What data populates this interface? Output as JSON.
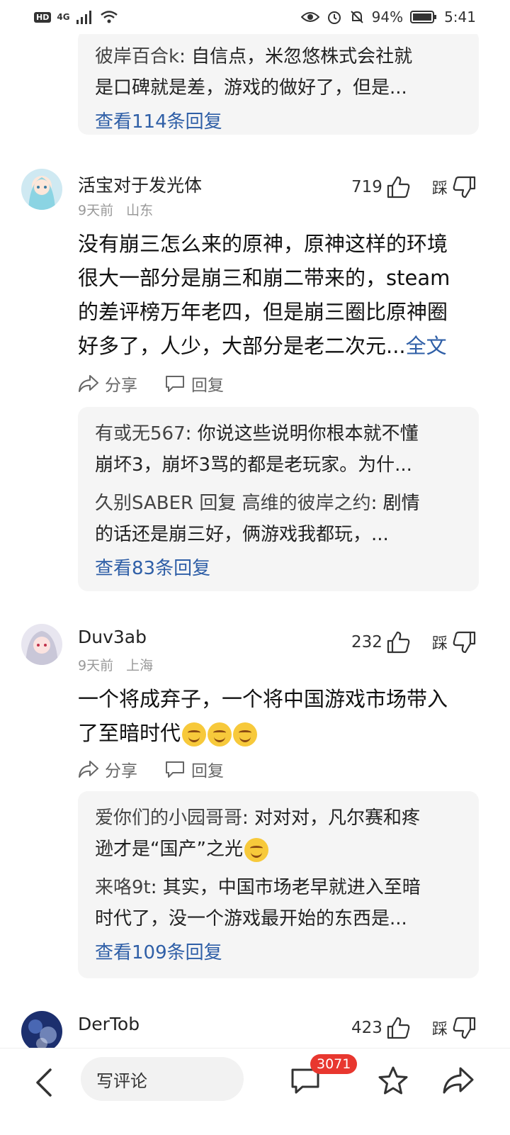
{
  "status_bar": {
    "network": "4G",
    "battery": "94%",
    "time": "5:41"
  },
  "top_reply_box": {
    "lines": [
      {
        "name": "彼岸百合k",
        "text": ": 自信点，米忽悠株式会社就"
      },
      {
        "name": "",
        "text": "是口碑就是差，游戏的做好了，但是..."
      }
    ],
    "view_more": "查看114条回复"
  },
  "comments": [
    {
      "username": "活宝对于发光体",
      "time": "9天前",
      "location": "山东",
      "likes": "719",
      "dislike_label": "踩",
      "text_lines": [
        "没有崩三怎么来的原神，原神这样的环境",
        "很大一部分是崩三和崩二带来的，steam",
        "的差评榜万年老四，但是崩三圈比原神圈",
        "好多了，人少，大部分是老二次元..."
      ],
      "full_text_label": "全文",
      "share_label": "分享",
      "reply_label": "回复",
      "replies": [
        {
          "name": "有或无567",
          "text": ": 你说这些说明你根本就不懂",
          "cont": "崩坏3，崩坏3骂的都是老玩家。为什..."
        },
        {
          "name": "久别SABER 回复 高维的彼岸之约",
          "text": ": 剧情",
          "cont": "的话还是崩三好，俩游戏我都玩，..."
        }
      ],
      "view_more": "查看83条回复"
    },
    {
      "username": "Duv3ab",
      "time": "9天前",
      "location": "上海",
      "likes": "232",
      "dislike_label": "踩",
      "text_lines": [
        "一个将成弃子，一个将中国游戏市场带入",
        "了至暗时代"
      ],
      "share_label": "分享",
      "reply_label": "回复",
      "replies": [
        {
          "name": "爱你们的小园哥哥",
          "text": ": 对对对，凡尔赛和疼",
          "cont": "逊才是“国产”之光"
        },
        {
          "name": "来咯9t",
          "text": ": 其实，中国市场老早就进入至暗",
          "cont": "时代了，没一个游戏最开始的东西是..."
        }
      ],
      "view_more": "查看109条回复"
    },
    {
      "username": "DerTob",
      "likes": "423",
      "dislike_label": "踩"
    }
  ],
  "bottom_bar": {
    "write_placeholder": "写评论",
    "comment_count": "3071"
  },
  "colors": {
    "link": "#2f5fa7",
    "badge": "#e8372f",
    "reply_bg": "#f5f5f5"
  }
}
